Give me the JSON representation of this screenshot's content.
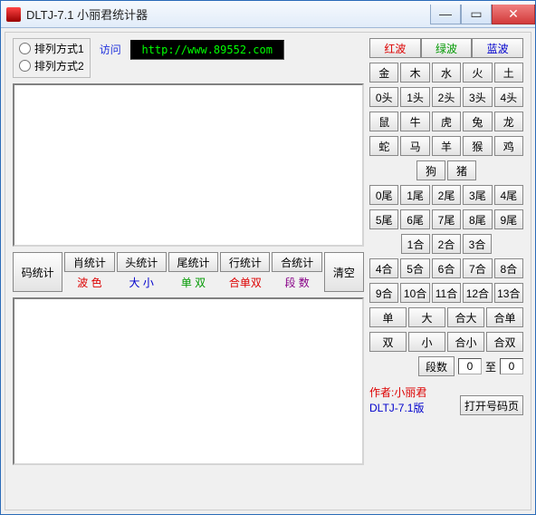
{
  "window": {
    "title": "DLTJ-7.1 小丽君统计器"
  },
  "arrangement": {
    "opt1": "排列方式1",
    "opt2": "排列方式2"
  },
  "visit_label": "访问",
  "url": "http://www.89552.com",
  "stats": {
    "col0": {
      "btn": "码统计"
    },
    "col1": {
      "btn": "肖统计",
      "sub": "波 色"
    },
    "col2": {
      "btn": "头统计",
      "sub": "大 小"
    },
    "col3": {
      "btn": "尾统计",
      "sub": "单 双"
    },
    "col4": {
      "btn": "行统计",
      "sub": "合单双"
    },
    "col5": {
      "btn": "合统计",
      "sub": "段 数"
    },
    "clear": "清空"
  },
  "waves": {
    "red": "红波",
    "green": "绿波",
    "blue": "蓝波"
  },
  "row_elements": [
    "金",
    "木",
    "水",
    "火",
    "土"
  ],
  "row_heads": [
    "0头",
    "1头",
    "2头",
    "3头",
    "4头"
  ],
  "zodiac1": [
    "鼠",
    "牛",
    "虎",
    "兔",
    "龙"
  ],
  "zodiac2": [
    "蛇",
    "马",
    "羊",
    "猴",
    "鸡"
  ],
  "zodiac3": [
    "狗",
    "猪"
  ],
  "tails1": [
    "0尾",
    "1尾",
    "2尾",
    "3尾",
    "4尾"
  ],
  "tails2": [
    "5尾",
    "6尾",
    "7尾",
    "8尾",
    "9尾"
  ],
  "he_row_a": [
    "1合",
    "2合",
    "3合"
  ],
  "he_row_b": [
    "4合",
    "5合",
    "6合",
    "7合",
    "8合"
  ],
  "he_row_c": [
    "9合",
    "10合",
    "11合",
    "12合",
    "13合"
  ],
  "quad1": [
    "单",
    "大",
    "合大",
    "合单"
  ],
  "quad2": [
    "双",
    "小",
    "合小",
    "合双"
  ],
  "seg": {
    "label": "段数",
    "from": "0",
    "to_label": "至",
    "to": "0"
  },
  "author_line1": "作者:小丽君",
  "author_line2": "DLTJ-7.1版",
  "open_btn": "打开号码页"
}
